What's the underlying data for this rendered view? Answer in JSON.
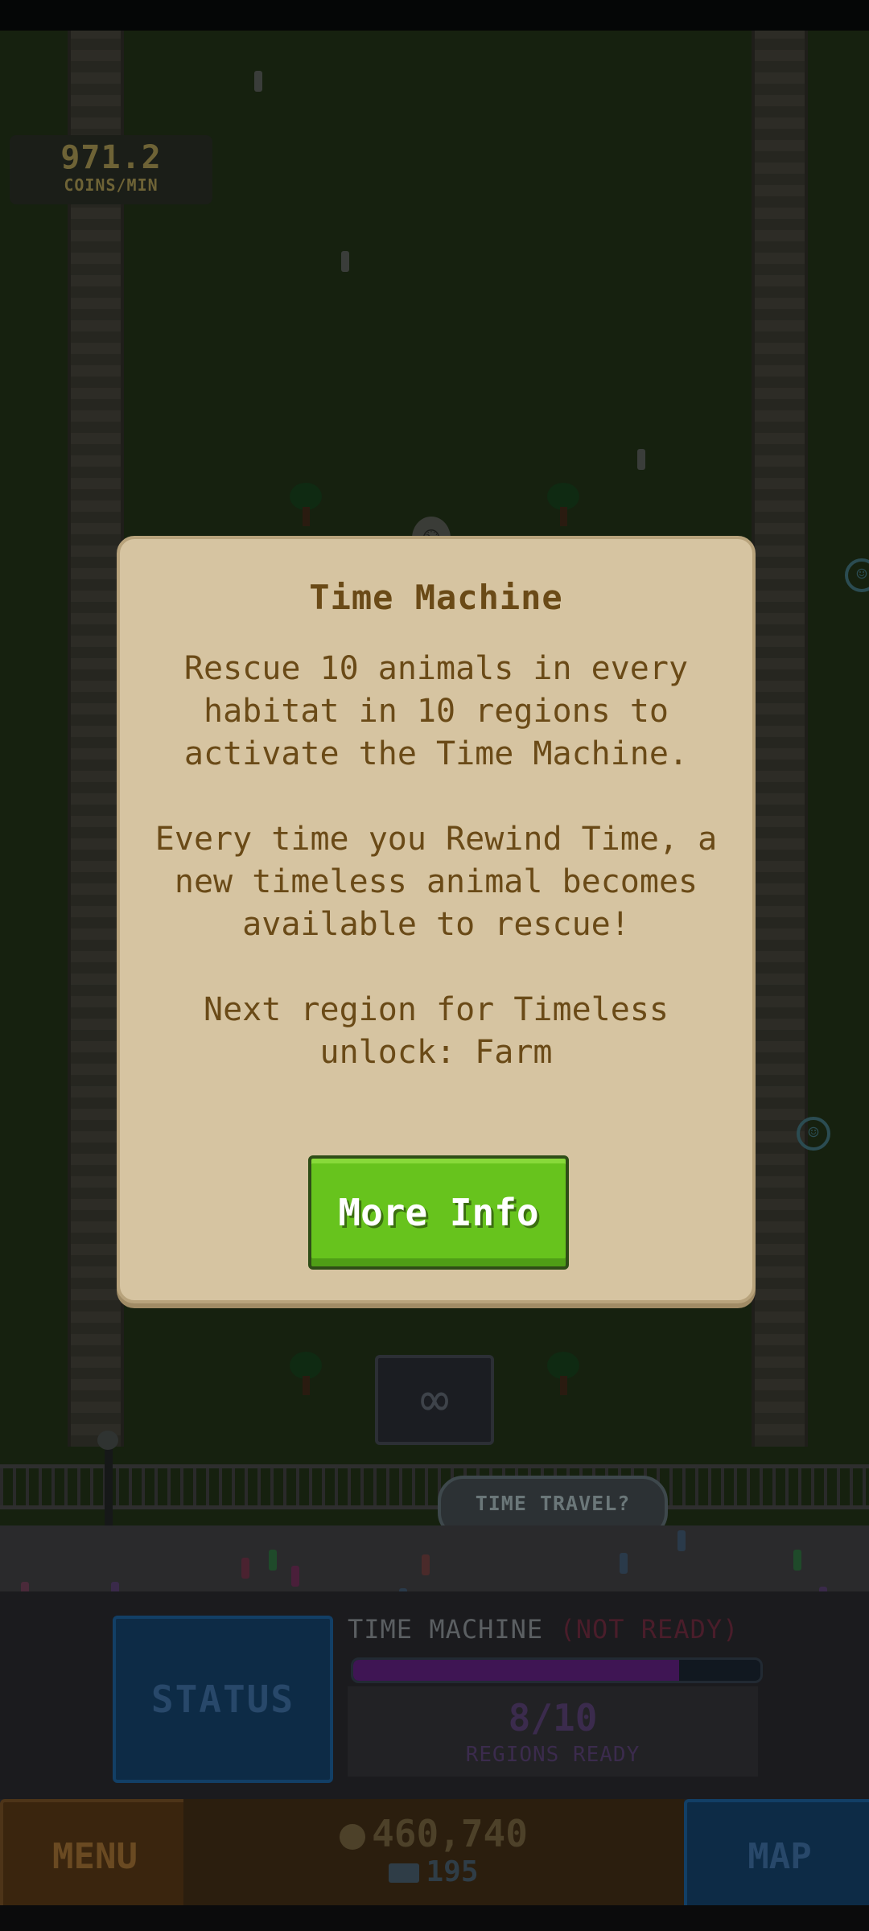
{
  "hud": {
    "coins_rate": "971.2",
    "coins_rate_unit": "COINS/MIN"
  },
  "scene": {
    "sign_label": "TIME TRAVEL?",
    "machine_icon": "infinity-icon"
  },
  "modal": {
    "title": "Time Machine",
    "paragraph1": "Rescue 10 animals in every habitat in 10 regions to activate the Time Machine.",
    "paragraph2": "Every time you Rewind Time, a new timeless animal becomes available to rescue!",
    "paragraph3": "Next region for Timeless unlock: Farm",
    "button_label": "More Info",
    "button_color": "#67c31d"
  },
  "panel": {
    "status_label": "STATUS",
    "time_machine_label": "TIME MACHINE",
    "not_ready_label": "(NOT READY)",
    "progress_fraction": 0.8,
    "regions_count": "8/10",
    "regions_label": "REGIONS READY"
  },
  "bottom_bar": {
    "menu_label": "MENU",
    "map_label": "MAP",
    "coins": "460,740",
    "tickets": "195"
  }
}
